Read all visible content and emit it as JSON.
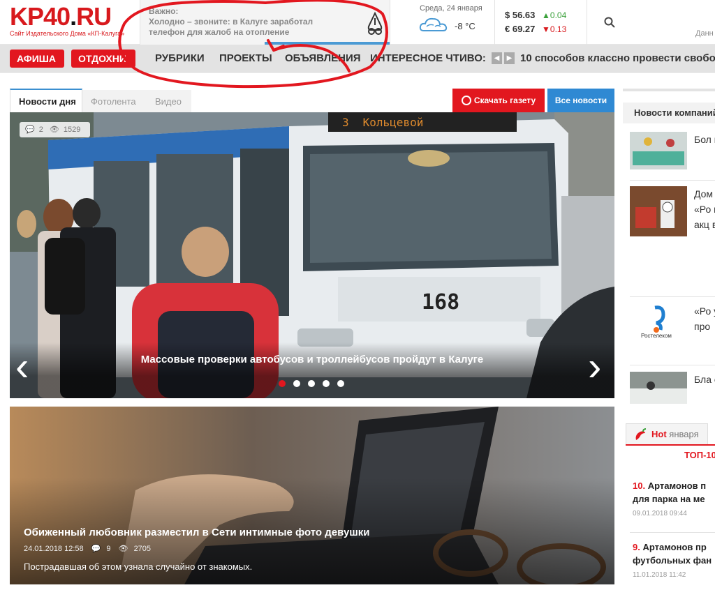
{
  "header": {
    "logo_text": "KP40",
    "logo_dot": ".",
    "logo_tld": "RU",
    "logo_subtitle": "Сайт Издательского Дома «КП-Калуга»",
    "important_label": "Важно:",
    "important_text": "Холодно – звоните: в Калуге заработал телефон для жалоб на отопление",
    "weather_date": "Среда, 24 января",
    "weather_temp": "-8 °C",
    "usd_value": "56.63",
    "usd_change": "0.04",
    "eur_value": "69.27",
    "eur_change": "0.13",
    "usd_symbol": "$",
    "eur_symbol": "€",
    "up_arrow": "▲",
    "down_arrow": "▼",
    "corner_text": "Данн"
  },
  "nav": {
    "afisha": "АФИША",
    "otdykh": "ОТДОХНИ",
    "rubriki": "РУБРИКИ",
    "proekty": "ПРОЕКТЫ",
    "obyavleniya": "ОБЪЯВЛЕНИЯ",
    "interesting": "ИНТЕРЕСНОЕ ЧТИВО:",
    "prev": "◀",
    "next": "▶",
    "ticker": "10 способов классно провести свободное время"
  },
  "tabs": {
    "news_day": "Новости дня",
    "photo": "Фотолента",
    "video": "Видео",
    "download": "Скачать газету",
    "all_news": "Все новости"
  },
  "hero": {
    "comments": "2",
    "views": "1529",
    "title": "Массовые проверки автобусов и троллейбусов пройдут в Калуге",
    "bus_route_number": "3",
    "bus_route_name": "Кольцевой",
    "bus_number": "168",
    "prev_arrow": "‹",
    "next_arrow": "›",
    "slides_total": 5,
    "active_slide": 1
  },
  "feature2": {
    "title": "Обиженный любовник разместил в Сети интимные фото девушки",
    "date": "24.01.2018 12:58",
    "comments": "9",
    "views": "2705",
    "lead": "Пострадавшая об этом узнала случайно от знакомых."
  },
  "sidebar": {
    "company_news_title": "Новости компаний",
    "items": [
      {
        "text": "Бол мы"
      },
      {
        "text": "Дом вид «Ро и по акц вес"
      },
      {
        "text": "«Ро услу про",
        "brand": "Ростелеком"
      },
      {
        "text": "Бла с М"
      }
    ],
    "hot_label": "Hot",
    "hot_month": "января",
    "top_label": "ТОП-10",
    "top_items": [
      {
        "num": "10.",
        "title_line1": "Артамонов п",
        "title_line2": "для парка на ме",
        "date": "09.01.2018 09:44"
      },
      {
        "num": "9.",
        "title_line1": "Артамонов пр",
        "title_line2": "футбольных фан",
        "date": "11.01.2018 11:42"
      }
    ]
  },
  "colors": {
    "brand_red": "#e2171f",
    "accent_blue": "#2f89d3",
    "nav_gray": "#e3e3e3",
    "annotation_red": "#e2171f"
  }
}
